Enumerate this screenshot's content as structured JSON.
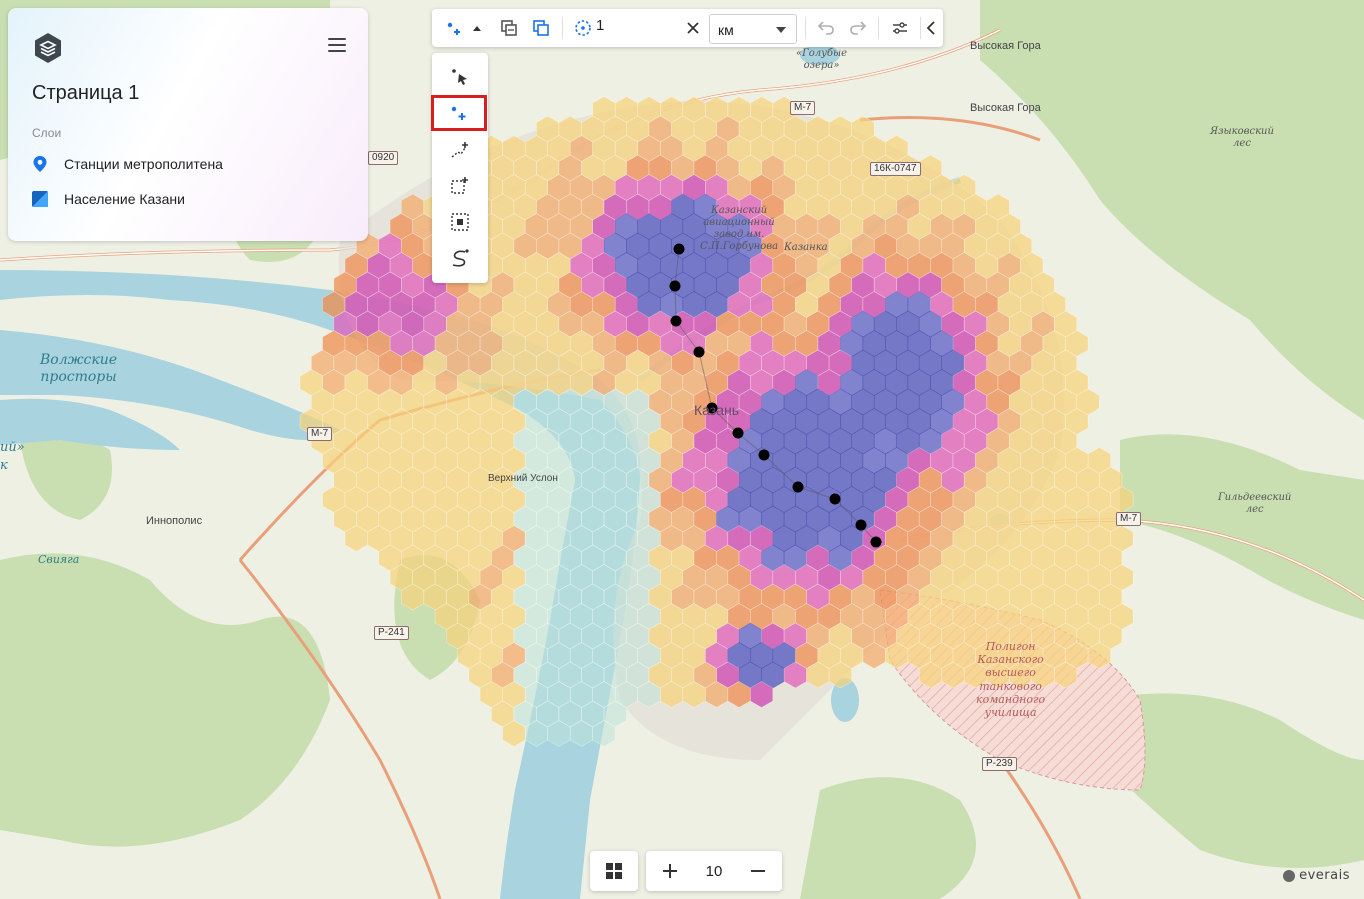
{
  "panel": {
    "page_title": "Страница 1",
    "layers_heading": "Слои",
    "layers": [
      {
        "label": "Станции метрополитена",
        "icon": "location-pin-icon",
        "color": "#1a73e8"
      },
      {
        "label": "Население Казани",
        "icon": "polygon-layer-icon",
        "color": "#1565c0"
      }
    ]
  },
  "toolbar": {
    "buffer_value": "1",
    "unit": "км"
  },
  "zoom": {
    "level": "10"
  },
  "brand": {
    "name": "everais"
  },
  "map": {
    "labels": {
      "volzhskie": "Волжские\nпросторы",
      "vysokaya1": "Высокая Гора",
      "vysokaya2": "Высокая Гора",
      "golubye": "«Голубые\nозера»",
      "yazykovsky": "Языковский\nлес",
      "aviazavod": "Казанский\nавиационный\nзавод им.\nС.П.Горбунова",
      "kazanka": "Казанка",
      "kazan": "Казань",
      "verkhny": "Верхний Услон",
      "innopolis": "Иннополис",
      "sviyaga": "Свияга",
      "gildeevsky": "Гильдеевский\nлес",
      "polygon": "Полигон\nКазанского\nвысшего\nтанкового\nкомандного\nучилища",
      "edge1": "ий»",
      "edge2": "к"
    },
    "roads": {
      "m7a": "М-7",
      "m7b": "М-7",
      "m7c": "М-7",
      "r241": "Р-241",
      "r239": "Р-239",
      "k16": "16К-0747",
      "k0920": "0920"
    },
    "metro_stations": [
      {
        "lat": 0,
        "lon": 0
      }
    ]
  }
}
